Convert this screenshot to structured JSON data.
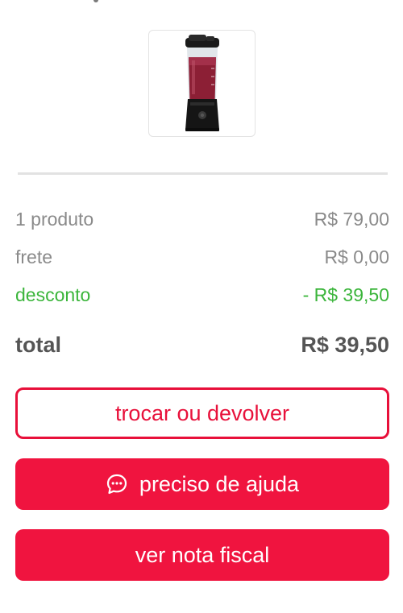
{
  "product": {
    "image_icon": "blender-bottle-icon"
  },
  "summary": {
    "products": {
      "label": "1 produto",
      "value": "R$ 79,00"
    },
    "shipping": {
      "label": "frete",
      "value": "R$ 0,00"
    },
    "discount": {
      "label": "desconto",
      "value": "- R$ 39,50"
    },
    "total": {
      "label": "total",
      "value": "R$ 39,50"
    }
  },
  "actions": {
    "exchange_label": "trocar ou devolver",
    "help_label": "preciso de ajuda",
    "help_icon": "chat-bubble-icon",
    "invoice_label": "ver nota fiscal"
  },
  "colors": {
    "accent": "#f0143f",
    "discount": "#3bb53b",
    "muted_text": "#8a8a8a",
    "total_text": "#555555"
  }
}
